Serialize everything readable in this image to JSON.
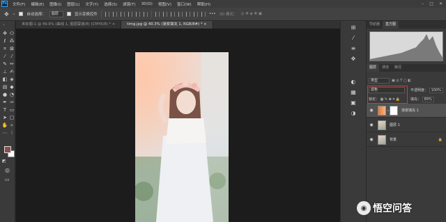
{
  "app": {
    "logo": "Ps"
  },
  "menu": [
    "文件(F)",
    "编辑(E)",
    "图像(I)",
    "图层(L)",
    "文字(Y)",
    "选择(S)",
    "滤镜(T)",
    "3D(D)",
    "视图(V)",
    "窗口(W)",
    "帮助(H)"
  ],
  "window_controls": [
    "–",
    "□",
    "✕"
  ],
  "options_bar": {
    "auto_select_label": "自动选择：",
    "auto_select_value": "图层",
    "show_transform_label": "显示变换控件",
    "mode_label": "3D 模式："
  },
  "tabs": [
    {
      "label": "未标题-1 @ 49.9% (曲线 1, 图层蒙版/8) (CMYK/8) * ×",
      "active": false
    },
    {
      "label": "timg.jpg @ 40.3% (渐变填充 1, RGB/8#) * ×",
      "active": true
    }
  ],
  "tools": {
    "col1": [
      "move-icon",
      "lasso-icon",
      "crop-icon",
      "eyedropper-icon",
      "brush-icon",
      "stamp-icon",
      "eraser-icon",
      "gradient-icon",
      "dodge-icon",
      "pen-icon",
      "type-icon",
      "path-select-icon",
      "hand-icon",
      "zoom-icon"
    ],
    "col2": [
      "marquee-icon",
      "quick-select-icon",
      "slice-icon",
      "ruler-icon",
      "pencil-icon",
      "history-brush-icon",
      "bg-eraser-icon",
      "paint-bucket-icon",
      "blur-icon",
      "freeform-pen-icon",
      "vertical-type-icon",
      "rectangle-icon",
      "rotate-view-icon",
      "more-icon"
    ],
    "fg_color": "#8a4d4b",
    "bg_color": "#ffffff"
  },
  "panels": {
    "top_tabs": [
      "导航器",
      "直方图"
    ],
    "top_active": 1,
    "layer_tabs": [
      "图层",
      "通道",
      "路径"
    ],
    "layer_active": 0,
    "filter_label": "类型",
    "blend_mode": "滤色",
    "opacity_label": "不透明度：",
    "opacity_value": "100%",
    "lock_label": "锁定：",
    "fill_label": "填充：",
    "fill_value": "89%",
    "layers": [
      {
        "name": "渐变填充 1",
        "selected": true
      },
      {
        "name": "图层 1",
        "selected": false
      },
      {
        "name": "背景",
        "selected": false
      }
    ]
  },
  "watermark": {
    "text": "悟空问答"
  }
}
